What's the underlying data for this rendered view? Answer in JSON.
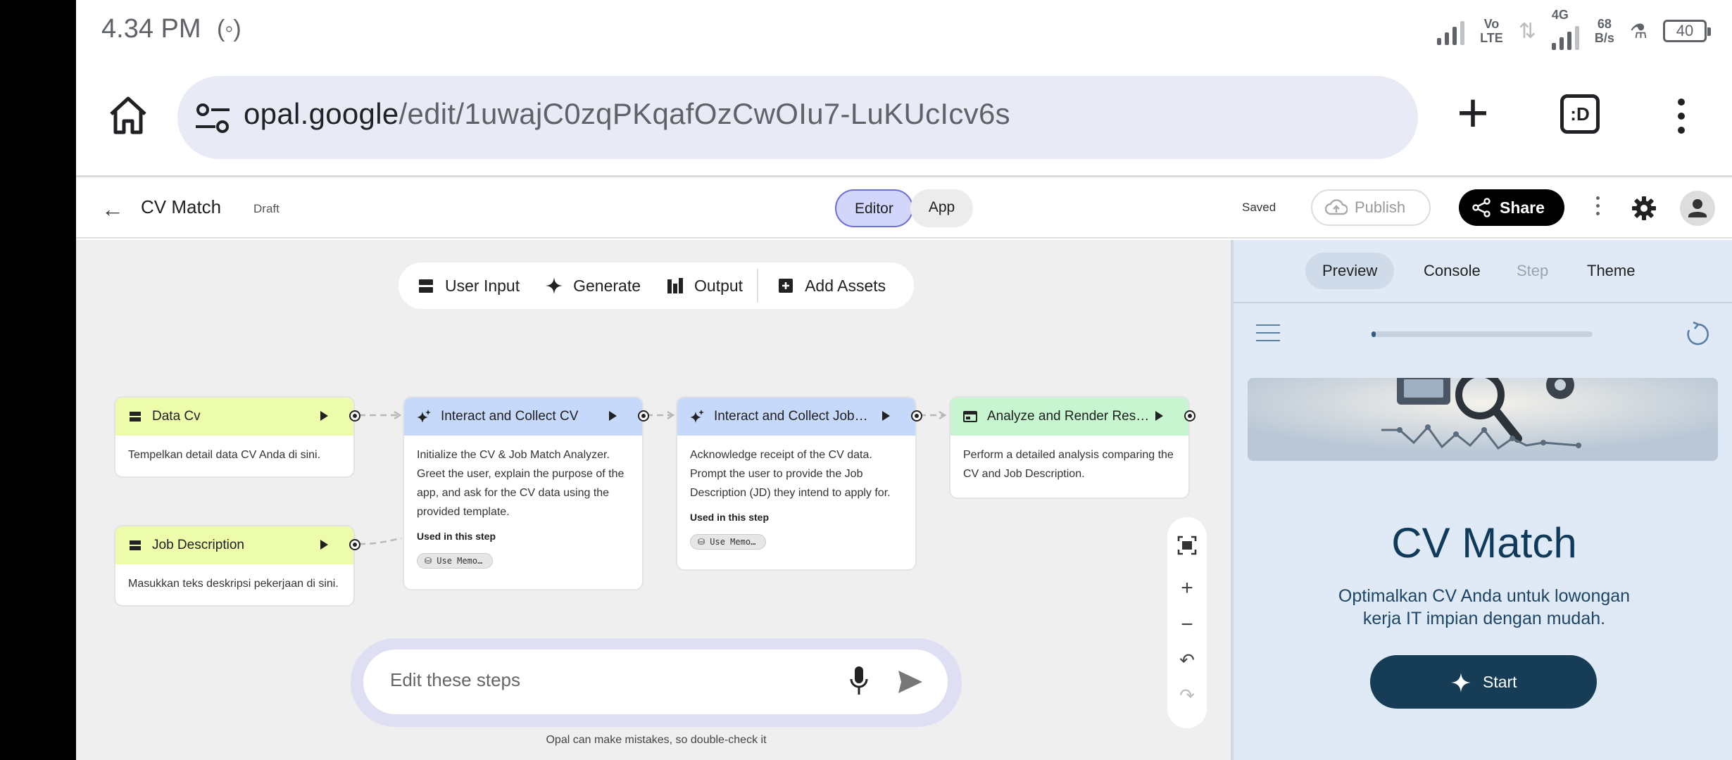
{
  "status_bar": {
    "time": "4.34 PM",
    "network_top": "Vo",
    "network_bottom": "LTE",
    "gen": "4G",
    "speed_value": "68",
    "speed_unit": "B/s",
    "battery": "40"
  },
  "browser": {
    "url_host": "opal.google",
    "url_path": "/edit/1uwajC0zqPKqafOzCwOIu7-LuKUcIcv6s",
    "tabs_label": ":D"
  },
  "app_header": {
    "title": "CV Match",
    "status": "Draft",
    "mode_editor": "Editor",
    "mode_app": "App",
    "saved": "Saved",
    "publish": "Publish",
    "share": "Share"
  },
  "toolbar": {
    "user_input": "User Input",
    "generate": "Generate",
    "output": "Output",
    "add_assets": "Add Assets"
  },
  "nodes": {
    "data_cv": {
      "title": "Data Cv",
      "body": "Tempelkan detail data CV Anda di sini."
    },
    "job_desc": {
      "title": "Job Description",
      "body": "Masukkan teks deskripsi pekerjaan di sini."
    },
    "collect_cv": {
      "title": "Interact and Collect CV",
      "body": "Initialize the CV & Job Match Analyzer. Greet the user, explain the purpose of the app, and ask for the CV data using the provided template.",
      "used_label": "Used in this step",
      "chip": "Use Memo…"
    },
    "collect_job": {
      "title": "Interact and Collect Job…",
      "body": "Acknowledge receipt of the CV data. Prompt the user to provide the Job Description (JD) they intend to apply for.",
      "used_label": "Used in this step",
      "chip": "Use Memo…"
    },
    "analyze": {
      "title": "Analyze and Render Res…",
      "body": "Perform a detailed analysis comparing the CV and Job Description."
    }
  },
  "prompt": {
    "placeholder": "Edit these steps",
    "disclaimer": "Opal can make mistakes, so double-check it"
  },
  "preview_panel": {
    "tabs": [
      "Preview",
      "Console",
      "Step",
      "Theme"
    ],
    "progress": 0.02,
    "title": "CV Match",
    "subtitle": "Optimalkan CV Anda untuk lowongan kerja IT impian dengan mudah.",
    "start": "Start"
  },
  "colors": {
    "input_node": "#edfcab",
    "generate_node": "#c7d9fb",
    "output_node": "#c6f5cf",
    "accent": "#163c56"
  }
}
